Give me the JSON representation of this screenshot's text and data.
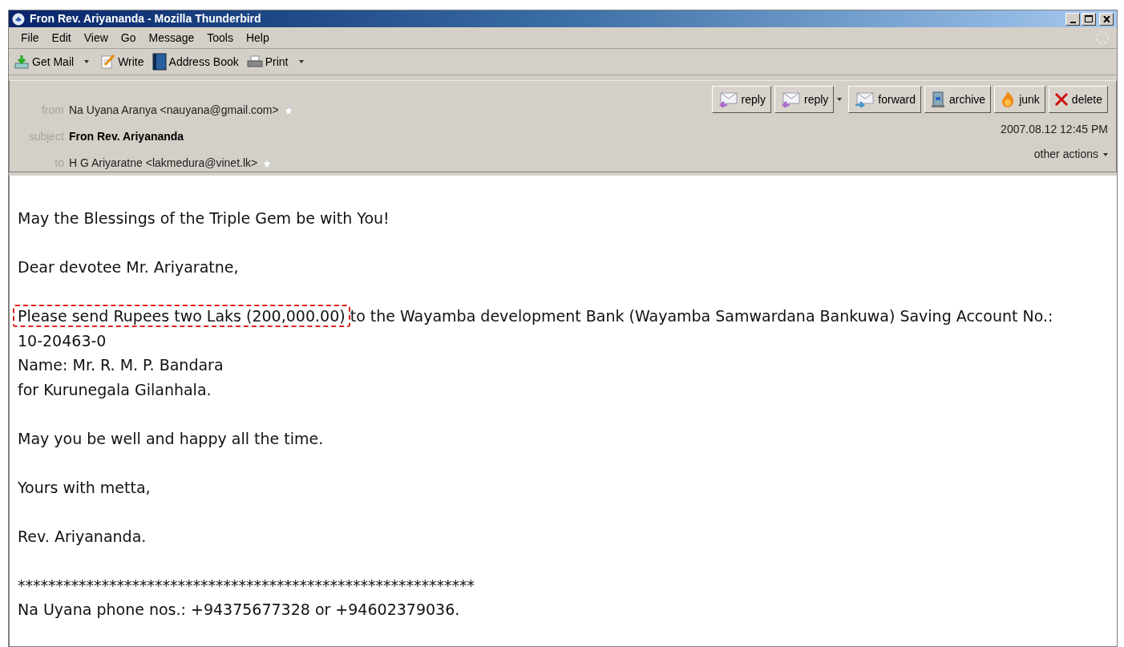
{
  "window": {
    "title": "Fron Rev. Ariyananda - Mozilla Thunderbird"
  },
  "menu": [
    "File",
    "Edit",
    "View",
    "Go",
    "Message",
    "Tools",
    "Help"
  ],
  "toolbar": [
    {
      "label": "Get Mail",
      "kind": "getmail",
      "dropdown": true
    },
    {
      "label": "Write",
      "kind": "write",
      "dropdown": false
    },
    {
      "label": "Address Book",
      "kind": "book",
      "dropdown": false
    },
    {
      "label": "Print",
      "kind": "print",
      "dropdown": true
    }
  ],
  "header": {
    "from_label": "from",
    "from": "Na Uyana Aranya <nauyana@gmail.com>",
    "subject_label": "subject",
    "subject": "Fron Rev. Ariyananda",
    "to_label": "to",
    "to": "H G Ariyaratne <lakmedura@vinet.lk>",
    "date": "2007.08.12 12:45 PM",
    "other_actions": "other actions",
    "buttons": [
      {
        "label": "reply",
        "kind": "reply",
        "dropdown": false
      },
      {
        "label": "reply",
        "kind": "reply",
        "dropdown": true
      },
      {
        "label": "forward",
        "kind": "forward",
        "dropdown": false
      },
      {
        "label": "archive",
        "kind": "archive",
        "dropdown": false
      },
      {
        "label": "junk",
        "kind": "junk",
        "dropdown": false
      },
      {
        "label": "delete",
        "kind": "delete",
        "dropdown": false
      }
    ]
  },
  "body": [
    {
      "lines": [
        {
          "parts": [
            {
              "text": "May the Blessings of the Triple Gem be with You!",
              "highlighted": false
            }
          ]
        }
      ]
    },
    {
      "lines": [
        {
          "parts": [
            {
              "text": "Dear devotee Mr. Ariyaratne,",
              "highlighted": false
            }
          ]
        }
      ]
    },
    {
      "lines": [
        {
          "parts": [
            {
              "text": "Please send Rupees two Laks (200,000.00)",
              "highlighted": true
            },
            {
              "text": " to the Wayamba development Bank (Wayamba Samwardana Bankuwa) Saving Account No.: 10-20463-0",
              "highlighted": false
            }
          ]
        },
        {
          "parts": [
            {
              "text": "Name: Mr. R. M. P. Bandara",
              "highlighted": false
            }
          ]
        },
        {
          "parts": [
            {
              "text": "for Kurunegala Gilanhala.",
              "highlighted": false
            }
          ]
        }
      ]
    },
    {
      "lines": [
        {
          "parts": [
            {
              "text": "May you be well and happy all the time.",
              "highlighted": false
            }
          ]
        }
      ]
    },
    {
      "lines": [
        {
          "parts": [
            {
              "text": "Yours with metta,",
              "highlighted": false
            }
          ]
        }
      ]
    },
    {
      "lines": [
        {
          "parts": [
            {
              "text": "Rev. Ariyananda.",
              "highlighted": false
            }
          ]
        }
      ]
    },
    {
      "lines": [
        {
          "parts": [
            {
              "text": "************************************************************",
              "highlighted": false
            }
          ]
        },
        {
          "parts": [
            {
              "text": "Na Uyana phone nos.: +94375677328 or +94602379036.",
              "highlighted": false
            }
          ]
        }
      ]
    }
  ]
}
